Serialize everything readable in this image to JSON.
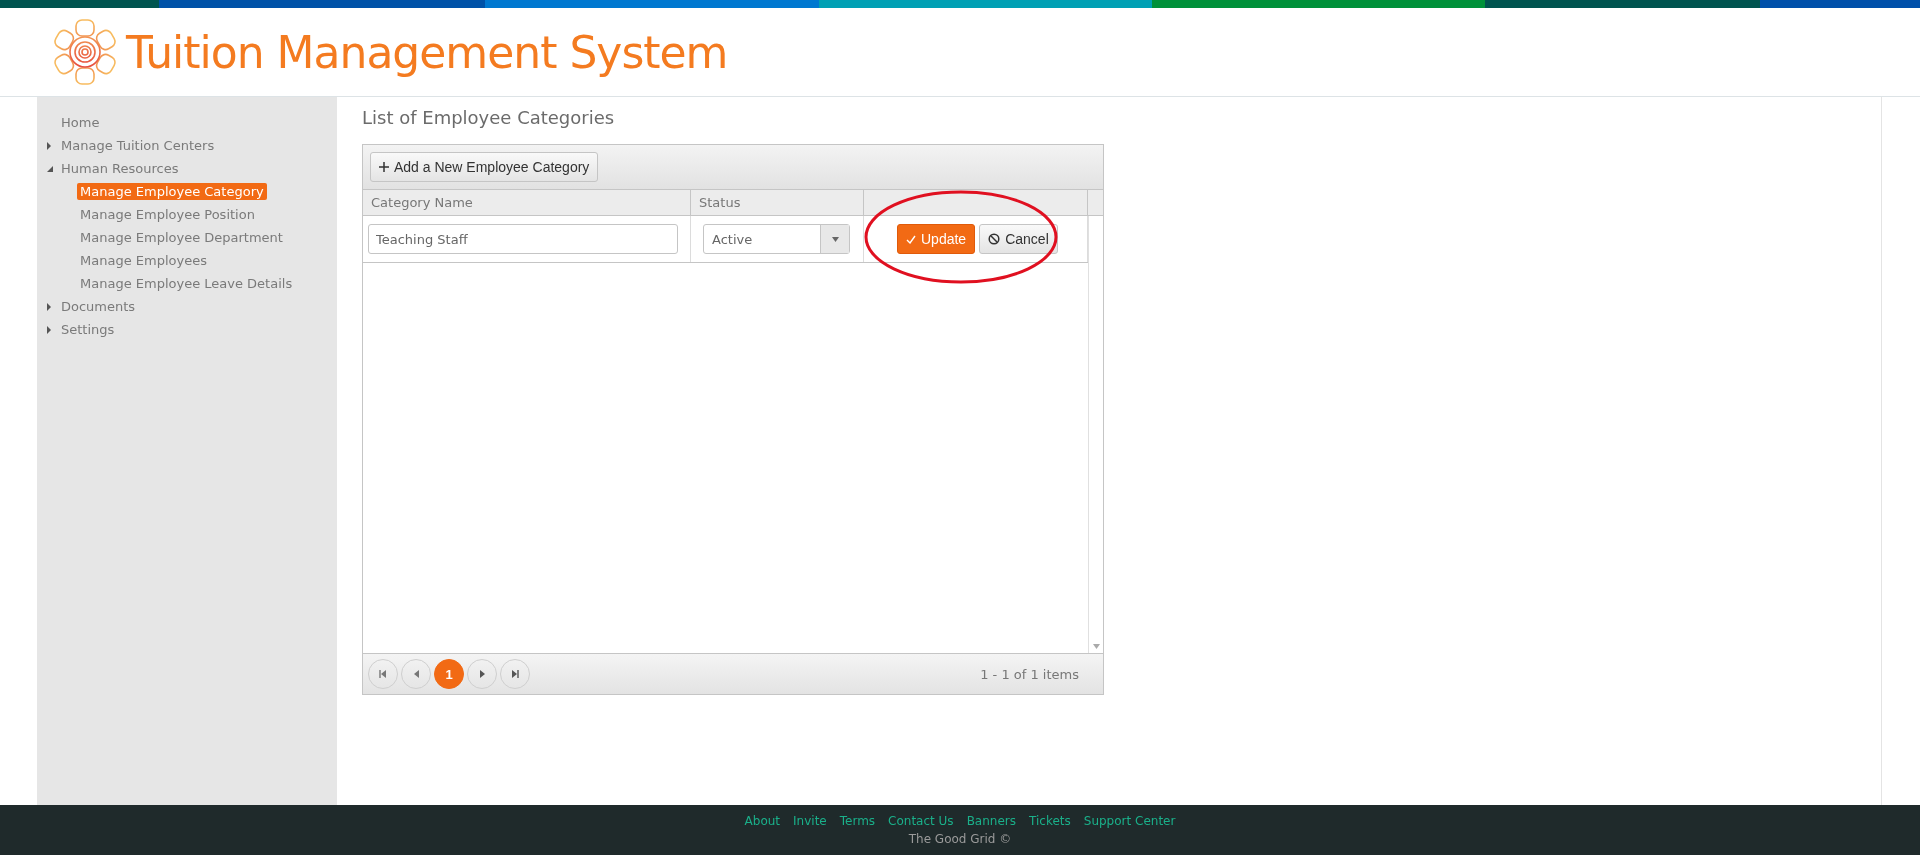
{
  "header": {
    "title": "Tuition Management System"
  },
  "sidebar": {
    "items": [
      {
        "label": "Home"
      },
      {
        "label": "Manage Tuition Centers",
        "expanded": false
      },
      {
        "label": "Human Resources",
        "expanded": true,
        "children": [
          {
            "label": "Manage Employee Category",
            "selected": true
          },
          {
            "label": "Manage Employee Position",
            "selected": false
          },
          {
            "label": "Manage Employee Department",
            "selected": false
          },
          {
            "label": "Manage Employees",
            "selected": false
          },
          {
            "label": "Manage Employee Leave Details",
            "selected": false
          }
        ]
      },
      {
        "label": "Documents",
        "expanded": false
      },
      {
        "label": "Settings",
        "expanded": false
      }
    ]
  },
  "page_title": "List of Employee Categories",
  "grid": {
    "toolbar_button": "Add a New Employee Category",
    "columns": [
      "Category Name",
      "Status"
    ],
    "edit_row": {
      "name_value": "Teaching Staff",
      "status_value": "Active",
      "update": "Update",
      "cancel": "Cancel"
    },
    "pager": {
      "pages": [
        {
          "label": "1",
          "selected": true
        }
      ],
      "info": "1 - 1 of 1 items"
    }
  },
  "footer": {
    "links": [
      "About",
      "Invite",
      "Terms",
      "Contact Us",
      "Banners",
      "Tickets",
      "Support Center"
    ],
    "copyright": "The Good Grid ©"
  }
}
